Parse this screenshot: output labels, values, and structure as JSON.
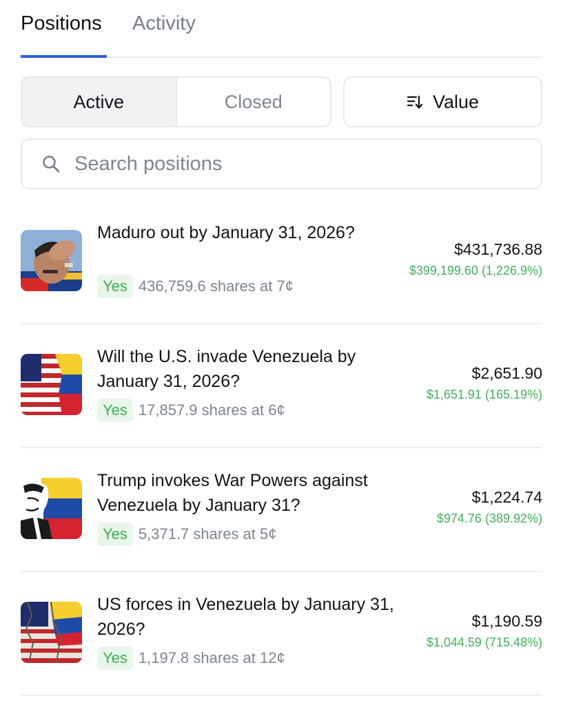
{
  "tabs": [
    {
      "label": "Positions",
      "active": true
    },
    {
      "label": "Activity",
      "active": false
    }
  ],
  "filter": {
    "active_label": "Active",
    "closed_label": "Closed",
    "sort_label": "Value",
    "sort_icon": "sort-icon"
  },
  "search": {
    "placeholder": "Search positions",
    "value": "",
    "icon": "search-icon"
  },
  "colors": {
    "accent": "#2f5fe0",
    "gain": "#44ad5a",
    "badge_bg": "#e9f6ea",
    "badge_text": "#3fae55"
  },
  "positions": [
    {
      "title": "Maduro out by January 31, 2026?",
      "outcome": "Yes",
      "shares": "436,759.6 shares at 7¢",
      "value": "$431,736.88",
      "pnl": "$399,199.60 (1,226.9%)",
      "icon": "maduro-thumbnail"
    },
    {
      "title": "Will the U.S. invade Venezuela by January 31, 2026?",
      "outcome": "Yes",
      "shares": "17,857.9 shares at 6¢",
      "value": "$2,651.90",
      "pnl": "$1,651.91 (165.19%)",
      "icon": "us-venezuela-flag-thumbnail"
    },
    {
      "title": "Trump invokes War Powers against Venezuela by January 31?",
      "outcome": "Yes",
      "shares": "5,371.7 shares at 5¢",
      "value": "$1,224.74",
      "pnl": "$974.76 (389.92%)",
      "icon": "trump-venezuela-thumbnail"
    },
    {
      "title": "US forces in Venezuela by January 31, 2026?",
      "outcome": "Yes",
      "shares": "1,197.8 shares at 12¢",
      "value": "$1,190.59",
      "pnl": "$1,044.59 (715.48%)",
      "icon": "us-venezuela-cracked-flag-thumbnail"
    }
  ]
}
